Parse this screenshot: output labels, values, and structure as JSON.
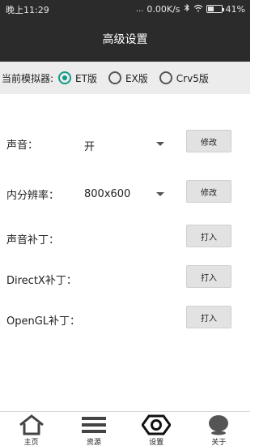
{
  "status": {
    "time": "晚上11:29",
    "indicators": "...",
    "network_speed": "0.00K/s",
    "battery": "41%",
    "icons": [
      "bluetooth-icon",
      "wifi-icon",
      "battery-icon"
    ]
  },
  "header": {
    "title": "高级设置"
  },
  "simulator": {
    "label": "当前模拟器:",
    "options": [
      {
        "label": "ET版",
        "checked": true
      },
      {
        "label": "EX版",
        "checked": false
      },
      {
        "label": "Crv5版",
        "checked": false
      }
    ]
  },
  "settings": {
    "sound": {
      "label": "声音：",
      "value": "开",
      "button": "修改"
    },
    "resolution": {
      "label": "内分辨率：",
      "value": "800x600",
      "button": "修改"
    },
    "sound_patch": {
      "label": "声音补丁：",
      "button": "打入"
    },
    "directx_patch": {
      "label": "DirectX补丁：",
      "button": "打入"
    },
    "opengl_patch": {
      "label": "OpenGL补丁：",
      "button": "打入"
    }
  },
  "navbar": {
    "items": [
      {
        "label": "主页",
        "icon": "home-icon"
      },
      {
        "label": "资源",
        "icon": "menu-icon"
      },
      {
        "label": "设置",
        "icon": "settings-icon"
      },
      {
        "label": "关于",
        "icon": "about-icon"
      }
    ]
  },
  "colors": {
    "topbar": "#2b2b2b",
    "accent": "#119a86",
    "sim_bar": "#ececec"
  }
}
